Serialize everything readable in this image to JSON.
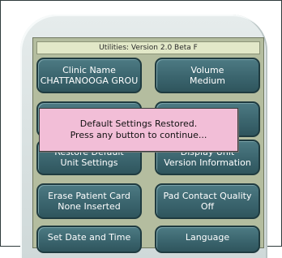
{
  "title_bar": "Utilities: Version 2.0 Beta F",
  "buttons": [
    {
      "line1": "Clinic Name",
      "line2": "CHATTANOOGA GROU"
    },
    {
      "line1": "Volume",
      "line2": "Medium"
    },
    {
      "line1": "",
      "line2": ""
    },
    {
      "line1": "",
      "line2": ""
    },
    {
      "line1": "Restore Default",
      "line2": "Unit Settings"
    },
    {
      "line1": "Display Unit",
      "line2": "Version Information"
    },
    {
      "line1": "Erase Patient Card",
      "line2": "None Inserted"
    },
    {
      "line1": "Pad Contact Quality",
      "line2": "Off"
    },
    {
      "line1": "Set Date and Time",
      "line2": ""
    },
    {
      "line1": "Language",
      "line2": ""
    }
  ],
  "popup": {
    "line1": "Default Settings Restored.",
    "line2": "Press any button to continue..."
  }
}
